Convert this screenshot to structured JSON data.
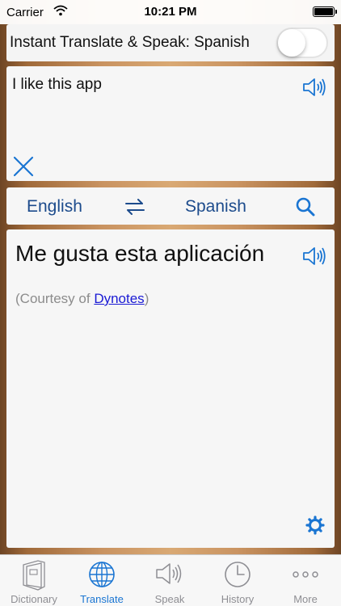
{
  "status_bar": {
    "carrier": "Carrier",
    "time": "10:21 PM"
  },
  "instant": {
    "label": "Instant Translate & Speak: Spanish",
    "enabled": false
  },
  "input": {
    "text": "I like this app"
  },
  "languages": {
    "source": "English",
    "target": "Spanish"
  },
  "result": {
    "text": "Me gusta esta aplicación",
    "courtesy_prefix": "(Courtesy of ",
    "courtesy_link": "Dynotes",
    "courtesy_suffix": ")"
  },
  "tabs": [
    {
      "label": "Dictionary",
      "icon": "dictionary-icon",
      "active": false
    },
    {
      "label": "Translate",
      "icon": "globe-icon",
      "active": true
    },
    {
      "label": "Speak",
      "icon": "speaker-icon",
      "active": false
    },
    {
      "label": "History",
      "icon": "clock-icon",
      "active": false
    },
    {
      "label": "More",
      "icon": "more-icon",
      "active": false
    }
  ],
  "colors": {
    "accent": "#1a75d2",
    "language_text": "#1c4b8c",
    "link": "#1a1ad4"
  }
}
